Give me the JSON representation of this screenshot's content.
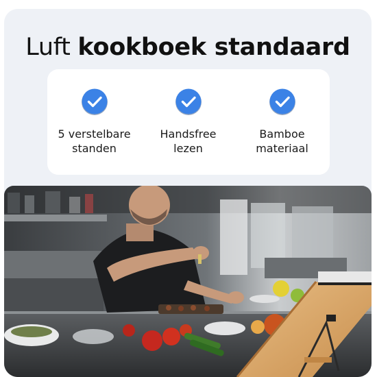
{
  "title": {
    "light": "Luft",
    "bold": "kookboek standaard"
  },
  "features": [
    {
      "label_line1": "5 verstelbare",
      "label_line2": "standen",
      "icon": "checkmark-circle-icon"
    },
    {
      "label_line1": "Handsfree",
      "label_line2": "lezen",
      "icon": "checkmark-circle-icon"
    },
    {
      "label_line1": "Bamboe",
      "label_line2": "materiaal",
      "icon": "checkmark-circle-icon"
    }
  ],
  "colors": {
    "accent": "#3b82e6",
    "card_background": "#eef1f6",
    "bamboo": "#d9a86a"
  },
  "photo": {
    "subject": "chef-seasoning-food-kitchen-photo"
  }
}
